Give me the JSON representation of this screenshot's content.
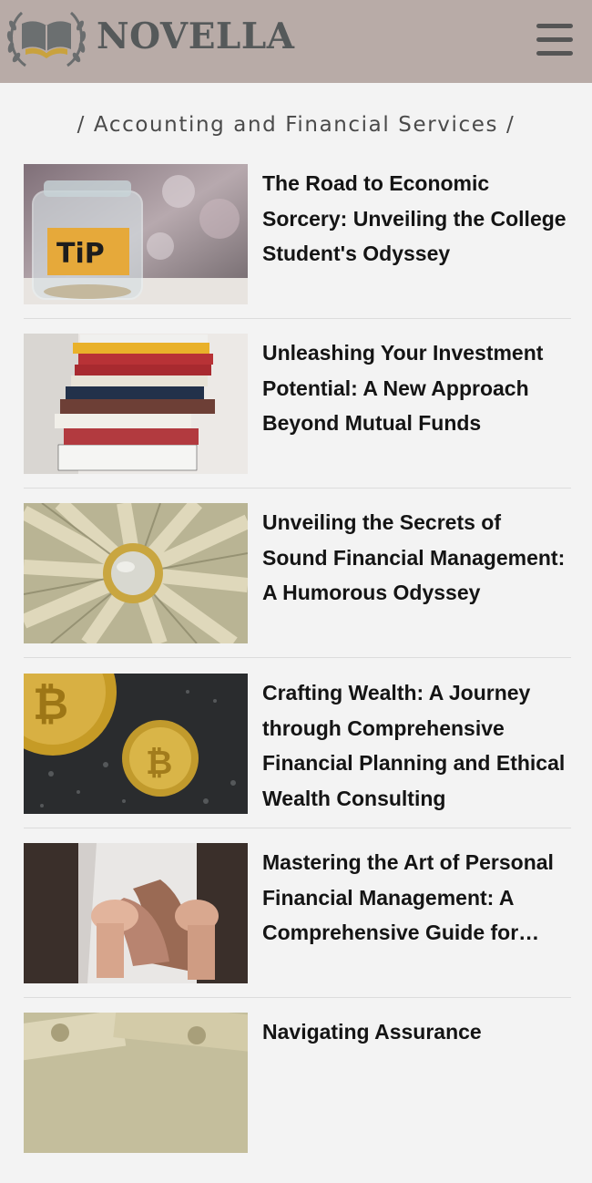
{
  "header": {
    "brand": "NOVELLA",
    "logo_icon": "open-book-laurel-icon",
    "menu_icon": "hamburger-menu-icon"
  },
  "category": "/ Accounting and Financial Services /",
  "articles": [
    {
      "title": "The Road to Economic Sorcery: Unveiling the College Student's Odyssey",
      "image": "tip-jar-image",
      "jar_label": "TiP"
    },
    {
      "title": "Unleashing Your Investment Potential: A New Approach Beyond Mutual Funds",
      "image": "book-stack-image"
    },
    {
      "title": "Unveiling the Secrets of Sound Financial Management: A Humorous Odyssey",
      "image": "coin-on-banknotes-image"
    },
    {
      "title": "Crafting Wealth: A Journey through Comprehensive Financial Planning and Ethical Wealth Consulting",
      "image": "bitcoin-coins-image"
    },
    {
      "title": "Mastering the Art of Personal Financial Management: A Comprehensive Guide for…",
      "image": "empty-wallet-image"
    },
    {
      "title": "Navigating Assurance",
      "image": "banknotes-image"
    }
  ],
  "colors": {
    "header_bg": "#b8aba7",
    "page_bg": "#f3f3f3",
    "brand_text": "#55595a",
    "title_text": "#141414"
  }
}
